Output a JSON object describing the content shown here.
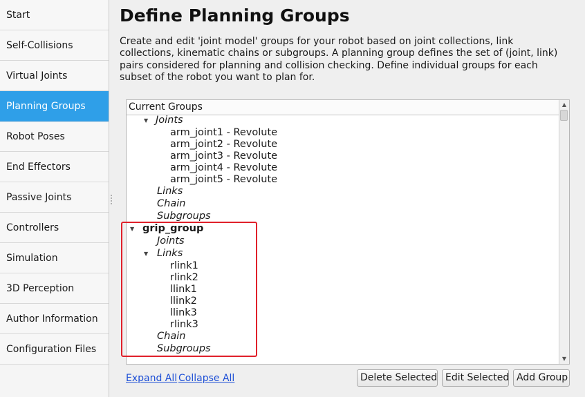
{
  "sidebar": {
    "items": [
      {
        "label": "Start"
      },
      {
        "label": "Self-Collisions"
      },
      {
        "label": "Virtual Joints"
      },
      {
        "label": "Planning Groups",
        "active": true
      },
      {
        "label": "Robot Poses"
      },
      {
        "label": "End Effectors"
      },
      {
        "label": "Passive Joints"
      },
      {
        "label": "Controllers"
      },
      {
        "label": "Simulation"
      },
      {
        "label": "3D Perception"
      },
      {
        "label": "Author Information"
      },
      {
        "label": "Configuration Files"
      }
    ]
  },
  "main": {
    "title": "Define Planning Groups",
    "description": "Create and edit 'joint model' groups for your robot based on joint collections, link collections, kinematic chains or subgroups. A planning group defines the set of (joint, link) pairs considered for planning and collision checking. Define individual groups for each subset of the robot you want to plan for."
  },
  "tree": {
    "header": "Current Groups",
    "rows": [
      {
        "label": "Joints",
        "level": 1,
        "style": "italic",
        "expanded": true
      },
      {
        "label": "arm_joint1 - Revolute",
        "level": 2
      },
      {
        "label": "arm_joint2 - Revolute",
        "level": 2
      },
      {
        "label": "arm_joint3 - Revolute",
        "level": 2
      },
      {
        "label": "arm_joint4 - Revolute",
        "level": 2
      },
      {
        "label": "arm_joint5 - Revolute",
        "level": 2
      },
      {
        "label": "Links",
        "level": 1,
        "style": "italic"
      },
      {
        "label": "Chain",
        "level": 1,
        "style": "italic"
      },
      {
        "label": "Subgroups",
        "level": 1,
        "style": "italic"
      },
      {
        "label": "grip_group",
        "level": 0,
        "style": "bold",
        "expanded": true
      },
      {
        "label": "Joints",
        "level": 1,
        "style": "italic"
      },
      {
        "label": "Links",
        "level": 1,
        "style": "italic",
        "expanded": true
      },
      {
        "label": "rlink1",
        "level": 2
      },
      {
        "label": "rlink2",
        "level": 2
      },
      {
        "label": "llink1",
        "level": 2
      },
      {
        "label": "llink2",
        "level": 2
      },
      {
        "label": "llink3",
        "level": 2
      },
      {
        "label": "rlink3",
        "level": 2
      },
      {
        "label": "Chain",
        "level": 1,
        "style": "italic"
      },
      {
        "label": "Subgroups",
        "level": 1,
        "style": "italic"
      }
    ]
  },
  "footer": {
    "expand_all": "Expand All",
    "collapse_all": "Collapse All",
    "delete_selected": "Delete Selected",
    "edit_selected": "Edit Selected",
    "add_group": "Add Group"
  },
  "colors": {
    "active_nav": "#2f9fe8",
    "highlight_box": "#e0202a",
    "link": "#1d4fd6"
  }
}
